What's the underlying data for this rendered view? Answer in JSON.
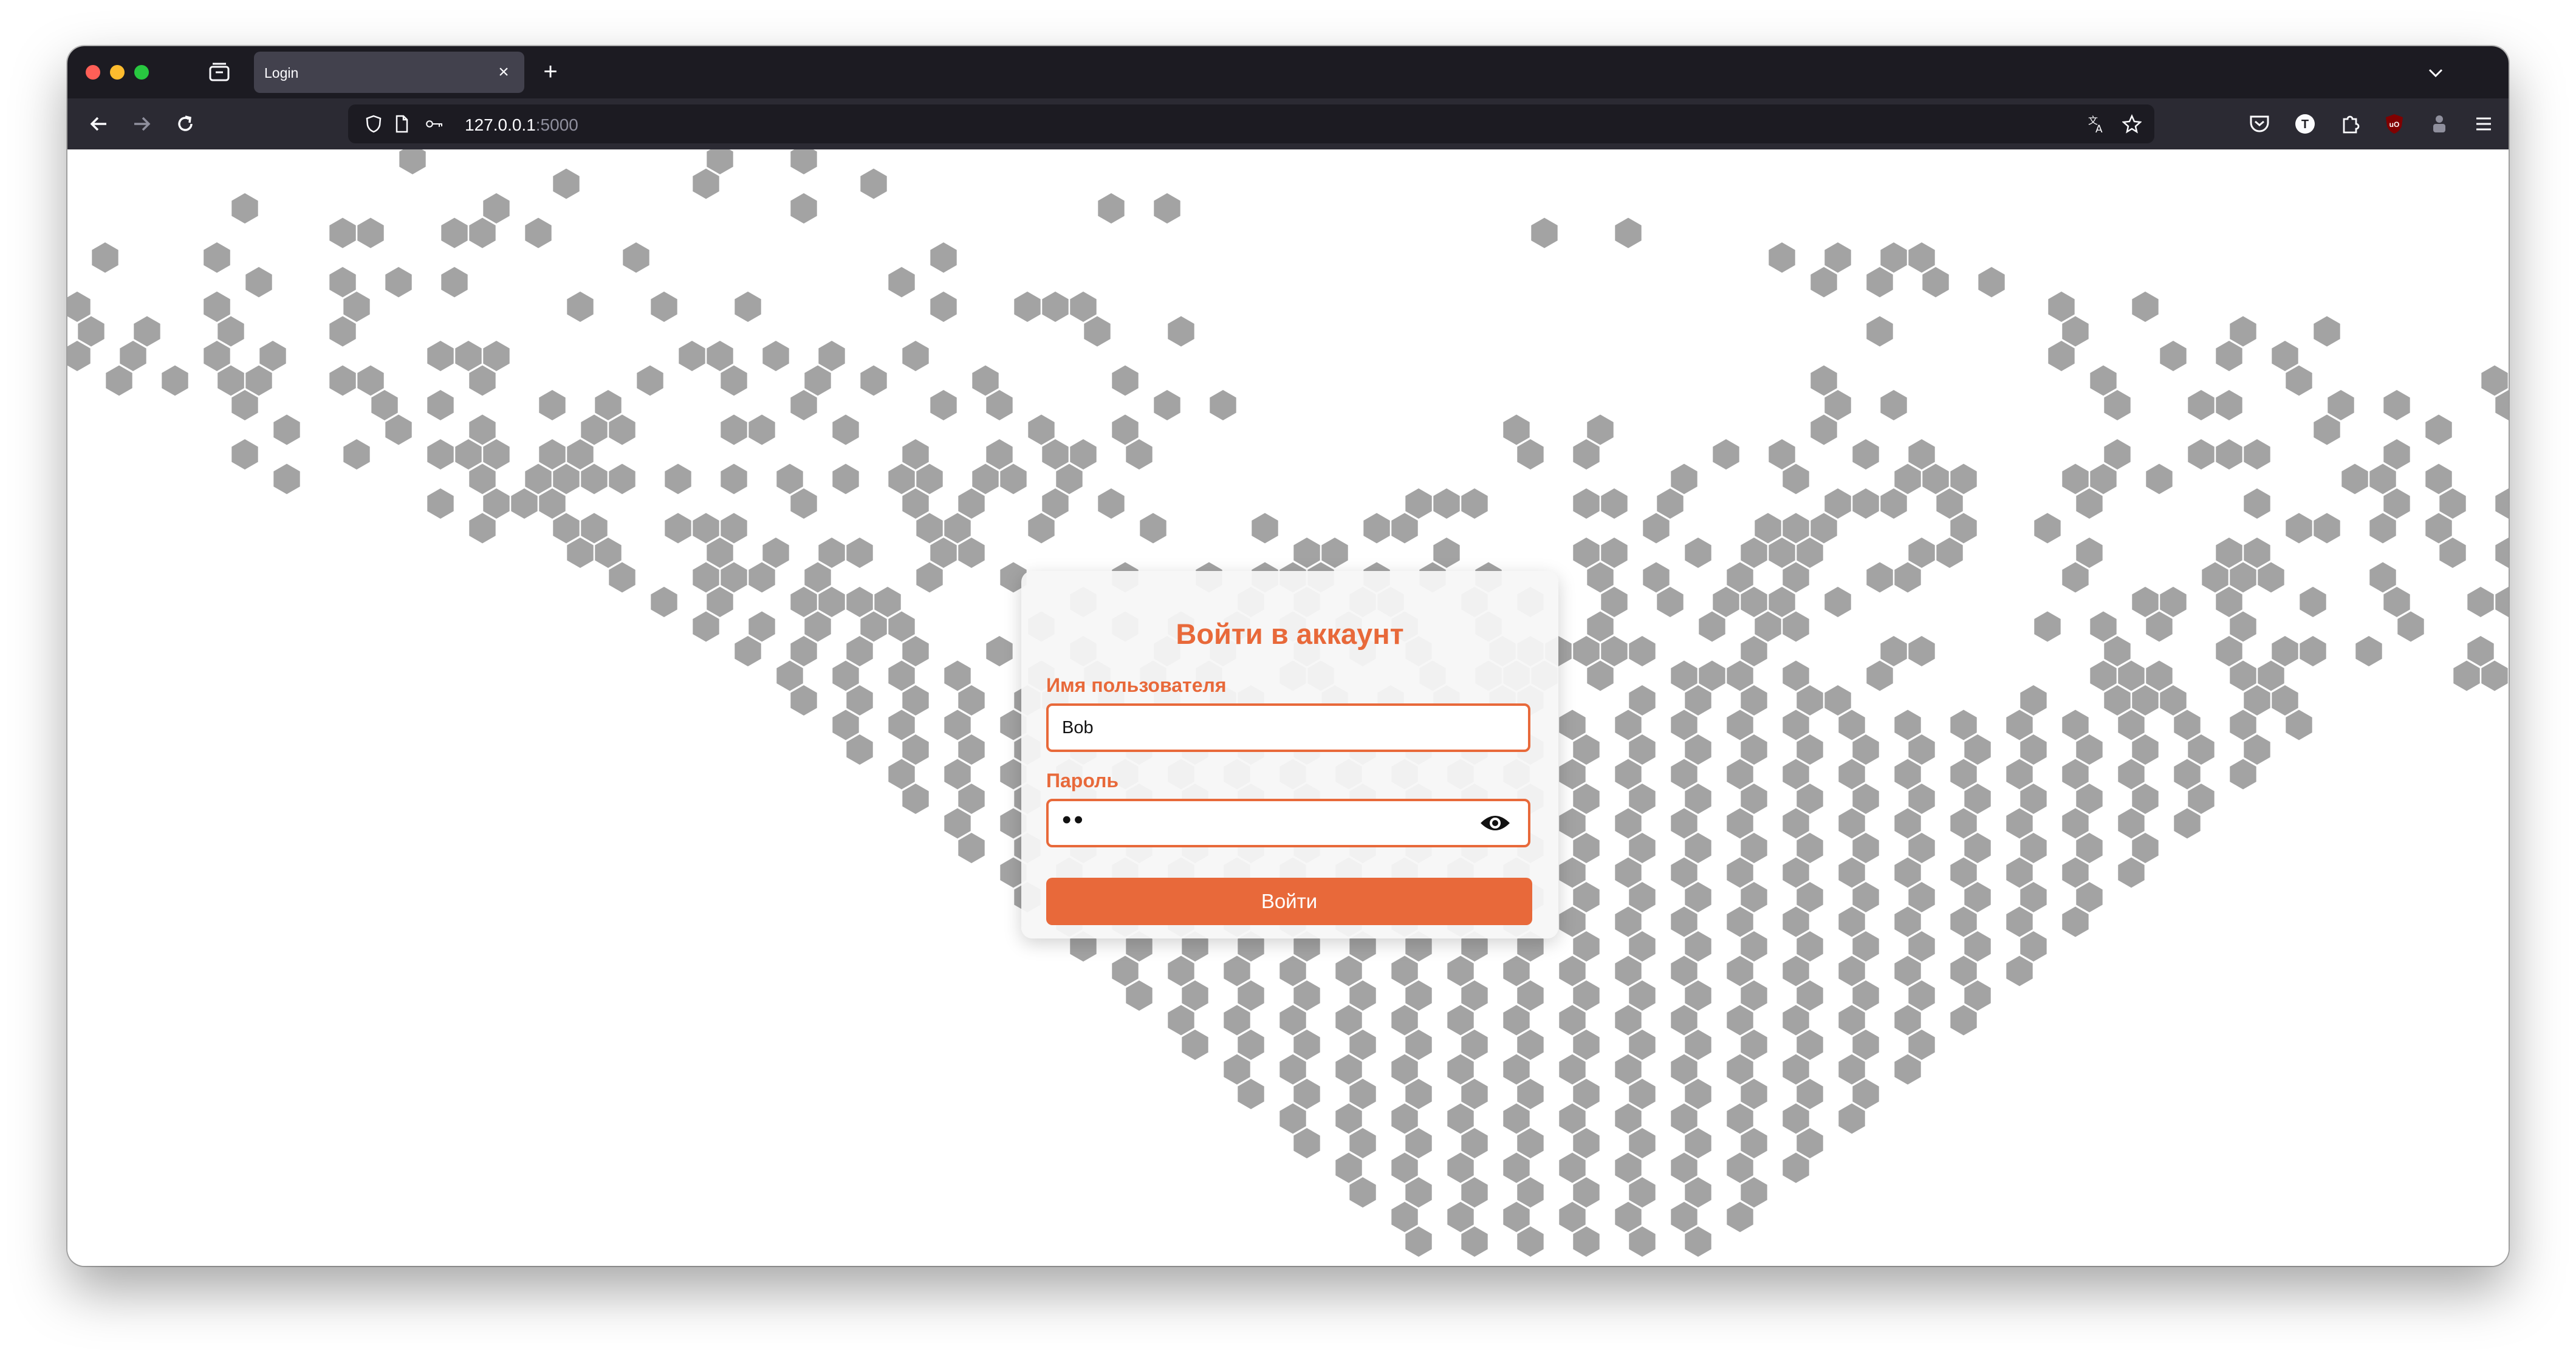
{
  "browser": {
    "tab": {
      "title": "Login"
    },
    "address": {
      "host": "127.0.0.1",
      "port": ":5000"
    }
  },
  "map": {
    "hex_color": "#a3a3a3",
    "rows": [
      [
        12,
        23,
        26
      ],
      [
        17,
        22,
        28
      ],
      [
        15,
        6,
        26,
        37,
        39
      ],
      [
        16,
        9,
        10,
        13,
        14,
        52,
        55
      ],
      [
        5,
        1,
        5,
        20,
        31,
        61,
        63,
        65,
        66,
        103,
        104,
        109,
        112,
        114,
        116
      ],
      [
        6,
        9,
        11,
        13,
        29,
        62,
        64,
        66,
        68,
        93,
        94,
        96,
        97,
        99,
        101,
        103,
        115,
        118
      ],
      [
        5,
        0,
        5,
        10,
        18,
        21,
        24,
        31,
        34,
        35,
        36,
        71,
        74,
        97,
        99,
        104,
        105,
        107,
        112,
        113,
        115,
        118
      ],
      [
        5,
        0,
        2,
        9,
        36,
        39,
        64,
        71,
        77,
        80,
        92,
        93,
        97,
        98,
        101,
        102,
        105,
        106,
        113,
        116,
        118
      ],
      [
        5,
        0,
        2,
        7,
        13,
        14,
        15,
        22,
        23,
        25,
        27,
        30,
        71,
        75,
        77,
        79,
        97,
        98,
        107,
        114,
        117,
        123
      ],
      [
        5,
        1,
        3,
        5,
        6,
        9,
        10,
        14,
        20,
        23,
        26,
        28,
        32,
        37,
        62,
        72,
        79,
        86,
        94,
        95,
        97,
        99,
        105,
        111,
        112,
        113,
        114,
        115,
        118
      ],
      [
        6,
        11,
        13,
        17,
        19,
        26,
        31,
        33,
        39,
        41,
        63,
        65,
        73,
        76,
        77,
        81,
        83,
        87,
        102,
        106
      ],
      [
        7,
        11,
        14,
        18,
        19,
        23,
        24,
        27,
        34,
        37,
        51,
        54,
        62,
        80,
        84,
        88,
        89,
        91,
        97,
        105,
        108,
        111,
        121,
        123
      ],
      [
        6,
        10,
        13,
        14,
        15,
        17,
        18,
        30,
        33,
        35,
        36,
        38,
        52,
        54,
        59,
        61,
        64,
        66,
        73,
        76,
        77,
        78,
        83,
        90,
        95,
        96,
        97,
        102,
        104,
        106
      ],
      [
        7,
        14,
        16,
        17,
        18,
        19,
        21,
        23,
        25,
        27,
        29,
        30,
        32,
        33,
        35,
        57,
        61,
        65,
        66,
        67,
        71,
        72,
        74,
        81,
        82,
        84,
        88,
        92,
        97,
        101
      ],
      [
        13,
        15,
        16,
        17,
        26,
        30,
        32,
        35,
        37,
        48,
        49,
        50,
        54,
        55,
        57,
        63,
        64,
        65,
        67,
        72,
        78,
        83,
        85,
        87,
        91,
        92,
        99,
        100,
        102,
        105
      ],
      [
        14,
        17,
        18,
        21,
        22,
        23,
        30,
        31,
        34,
        38,
        42,
        46,
        47,
        56,
        60,
        61,
        62,
        67,
        70,
        79,
        80,
        82,
        84,
        87,
        88,
        92,
        93,
        97,
        102
      ],
      [
        18,
        19,
        23,
        25,
        27,
        28,
        31,
        32,
        44,
        45,
        49,
        54,
        55,
        58,
        60,
        61,
        62,
        66,
        67,
        72,
        77,
        78,
        85,
        87,
        94,
        98,
        99,
        103
      ],
      [
        19,
        22,
        23,
        24,
        26,
        30,
        33,
        37,
        40,
        42,
        43,
        44,
        46,
        48,
        50,
        54,
        56,
        59,
        61,
        64,
        65,
        71,
        76,
        77,
        78,
        82
      ],
      [
        21,
        23,
        26,
        27,
        28,
        29,
        36,
        42,
        44,
        46,
        47,
        50,
        52,
        55,
        57,
        59,
        60,
        61,
        63,
        74,
        75,
        77,
        80,
        83,
        86,
        87
      ],
      [
        22,
        24,
        26,
        28,
        29,
        34,
        37,
        39,
        41,
        43,
        45,
        47,
        50,
        54,
        58,
        60,
        61,
        70,
        72,
        74,
        77,
        83,
        88,
        90
      ],
      [
        24,
        26,
        28,
        30,
        33,
        36,
        39,
        41,
        44,
        46,
        48,
        51,
        52,
        53,
        54,
        55,
        56,
        60,
        65,
        66,
        73,
        77,
        79,
        80,
        82,
        86
      ],
      [
        25,
        27,
        29,
        31,
        34,
        36,
        38,
        40,
        43,
        44,
        48,
        50,
        51,
        52,
        54,
        57,
        58,
        59,
        61,
        64,
        72,
        73,
        74,
        77,
        78,
        85,
        86
      ],
      [
        26,
        28,
        30,
        32,
        34,
        35,
        37,
        39,
        41,
        42,
        45,
        47,
        49,
        51,
        52,
        56,
        58,
        60,
        62,
        63,
        70,
        73,
        74,
        75,
        78,
        79
      ],
      [
        27,
        29,
        31,
        33,
        35,
        37,
        39,
        41,
        43,
        45,
        47,
        49,
        51,
        53,
        55,
        57,
        59,
        61,
        63,
        65,
        67,
        69,
        71,
        73,
        75,
        77,
        79
      ],
      [
        28,
        30,
        32,
        34,
        36,
        38,
        40,
        42,
        44,
        46,
        48,
        50,
        52,
        54,
        56,
        58,
        60,
        62,
        64,
        66,
        68,
        70,
        72,
        74,
        76,
        78
      ],
      [
        29,
        31,
        33,
        35,
        37,
        39,
        41,
        43,
        45,
        47,
        49,
        51,
        53,
        55,
        57,
        59,
        61,
        63,
        65,
        67,
        69,
        71,
        73,
        75,
        77
      ],
      [
        30,
        32,
        34,
        36,
        38,
        40,
        42,
        44,
        46,
        48,
        50,
        52,
        54,
        56,
        58,
        60,
        62,
        64,
        66,
        68,
        70,
        72,
        74,
        76
      ],
      [
        31,
        33,
        35,
        37,
        39,
        41,
        43,
        45,
        47,
        49,
        51,
        53,
        55,
        57,
        59,
        61,
        63,
        65,
        67,
        69,
        71,
        73,
        75
      ],
      [
        32,
        34,
        36,
        38,
        40,
        42,
        44,
        46,
        48,
        50,
        52,
        54,
        56,
        58,
        60,
        62,
        64,
        66,
        68,
        70,
        72,
        74
      ],
      [
        33,
        35,
        37,
        39,
        41,
        43,
        45,
        47,
        49,
        51,
        53,
        55,
        57,
        59,
        61,
        63,
        65,
        67,
        69,
        71,
        73
      ],
      [
        34,
        36,
        38,
        40,
        42,
        44,
        46,
        48,
        50,
        52,
        54,
        56,
        58,
        60,
        62,
        64,
        66,
        68,
        70,
        72
      ],
      [
        35,
        37,
        39,
        41,
        43,
        45,
        47,
        49,
        51,
        53,
        55,
        57,
        59,
        61,
        63,
        65,
        67,
        69,
        71
      ],
      [
        36,
        38,
        40,
        42,
        44,
        46,
        48,
        50,
        52,
        54,
        56,
        58,
        60,
        62,
        64,
        66,
        68,
        70
      ],
      [
        37,
        39,
        41,
        43,
        45,
        47,
        49,
        51,
        53,
        55,
        57,
        59,
        61,
        63,
        65,
        67,
        69
      ],
      [
        38,
        40,
        42,
        44,
        46,
        48,
        50,
        52,
        54,
        56,
        58,
        60,
        62,
        64,
        66,
        68
      ],
      [
        39,
        41,
        43,
        45,
        47,
        49,
        51,
        53,
        55,
        57,
        59,
        61,
        63,
        65,
        67
      ],
      [
        40,
        42,
        44,
        46,
        48,
        50,
        52,
        54,
        56,
        58,
        60,
        62,
        64,
        66
      ],
      [
        41,
        43,
        45,
        47,
        49,
        51,
        53,
        55,
        57,
        59,
        61,
        63,
        65
      ],
      [
        42,
        44,
        46,
        48,
        50,
        52,
        54,
        56,
        58,
        60,
        62,
        64
      ],
      [
        43,
        45,
        47,
        49,
        51,
        53,
        55,
        57,
        59,
        61,
        63
      ],
      [
        44,
        46,
        48,
        50,
        52,
        54,
        56,
        58,
        60,
        62
      ],
      [
        45,
        47,
        49,
        51,
        53,
        55,
        57,
        59,
        61
      ],
      [
        46,
        48,
        50,
        52,
        54,
        56,
        58,
        60
      ],
      [
        47,
        49,
        51,
        53,
        55,
        57,
        59
      ],
      [
        48,
        50,
        52,
        54,
        56,
        58
      ]
    ]
  },
  "login": {
    "title": "Войти в аккаунт",
    "username_label": "Имя пользователя",
    "username_value": "Bob",
    "password_label": "Пароль",
    "password_value": "••",
    "submit_label": "Войти"
  }
}
